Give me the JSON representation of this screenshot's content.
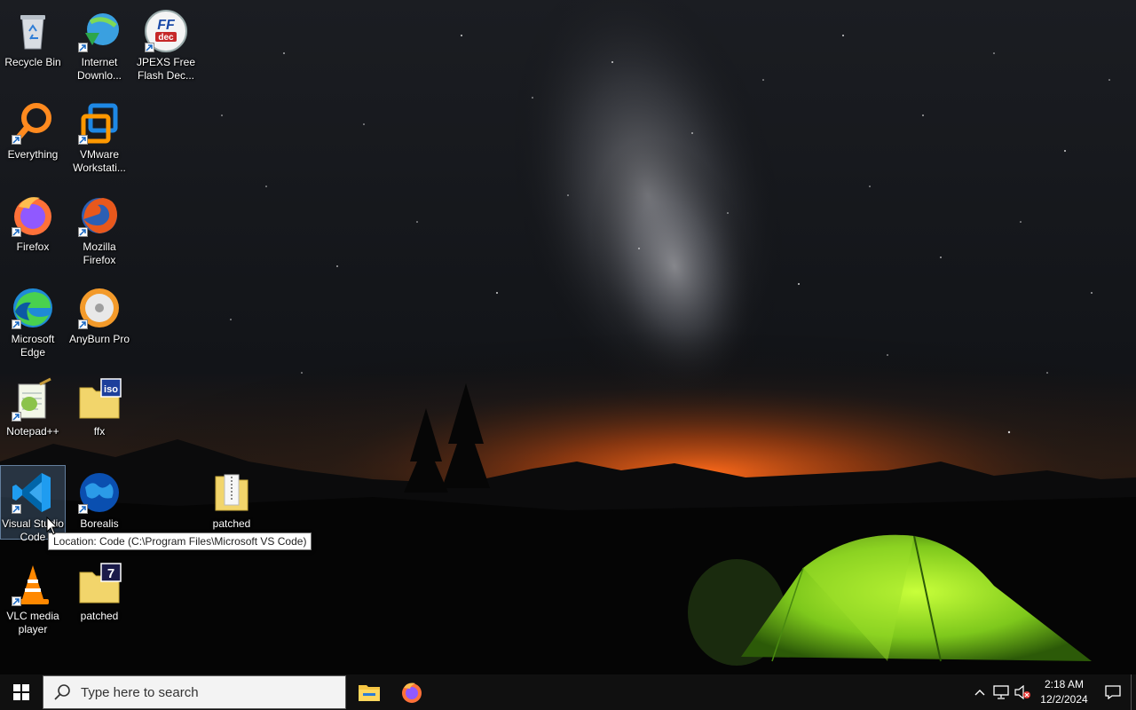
{
  "desktop": {
    "icons": [
      {
        "label": "Recycle Bin",
        "icon": "recycle-bin-icon"
      },
      {
        "label": "Internet Downlo...",
        "icon": "internet-download-manager-icon"
      },
      {
        "label": "JPEXS Free Flash Dec...",
        "icon": "jpexs-ffdec-icon",
        "glyph": "FF dec"
      },
      {
        "label": "Everything",
        "icon": "everything-search-icon"
      },
      {
        "label": "VMware Workstati...",
        "icon": "vmware-workstation-icon"
      },
      {
        "label": "Firefox",
        "icon": "firefox-icon"
      },
      {
        "label": "Mozilla Firefox",
        "icon": "mozilla-firefox-icon"
      },
      {
        "label": "Microsoft Edge",
        "icon": "microsoft-edge-icon"
      },
      {
        "label": "AnyBurn Pro",
        "icon": "anyburn-icon"
      },
      {
        "label": "Notepad++",
        "icon": "notepad-plus-plus-icon"
      },
      {
        "label": "ffx",
        "icon": "iso-folder-icon",
        "glyph": "iso"
      },
      {
        "label": "Visual Studio Code",
        "icon": "vscode-icon",
        "selected": true
      },
      {
        "label": "Borealis",
        "icon": "borealis-globe-icon"
      },
      {
        "label": "patched",
        "icon": "zip-folder-icon"
      },
      {
        "label": "VLC media player",
        "icon": "vlc-icon"
      },
      {
        "label": "patched",
        "icon": "7z-folder-icon",
        "glyph": "7"
      }
    ],
    "tooltip": "Location: Code (C:\\Program Files\\Microsoft VS Code)"
  },
  "taskbar": {
    "search_placeholder": "Type here to search",
    "pinned": [
      "file-explorer-icon",
      "firefox-icon"
    ],
    "tray": {
      "time": "2:18 AM",
      "date": "12/2/2024",
      "icons": [
        "chevron-up-icon",
        "network-icon",
        "volume-muted-icon"
      ]
    }
  },
  "colors": {
    "taskbar": "#101010",
    "search_box": "#f3f3f3",
    "selection": "#78a0d2"
  }
}
